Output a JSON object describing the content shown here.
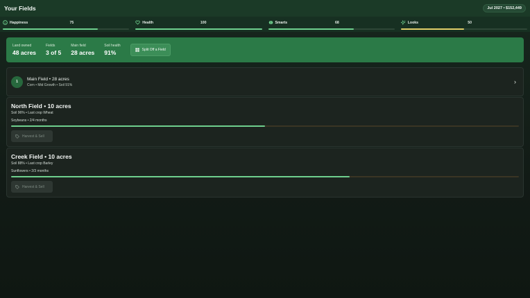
{
  "header": {
    "title": "Your Fields",
    "date": "Jul 2027",
    "money": "$152,449"
  },
  "stats": [
    {
      "label": "Happiness",
      "value": "75",
      "fill": 0.75,
      "icon": "smiley-icon",
      "color": "#6fd08e"
    },
    {
      "label": "Health",
      "value": "100",
      "fill": 1.0,
      "icon": "heart-icon",
      "color": "#6fd08e"
    },
    {
      "label": "Smarts",
      "value": "68",
      "fill": 0.68,
      "icon": "brain-icon",
      "color": "#6fd08e"
    },
    {
      "label": "Looks",
      "value": "50",
      "fill": 0.5,
      "icon": "sparkle-icon",
      "color": "#e2cf6a"
    }
  ],
  "summary": {
    "land_label": "Land owned",
    "land_value": "48 acres",
    "fields_label": "Fields",
    "fields_value": "3 of 5",
    "main_label": "Main field",
    "main_value": "28 acres",
    "soil_label": "Soil health",
    "soil_value": "91%",
    "split_label": "Split Off a Field"
  },
  "main_field": {
    "number": "1",
    "title": "Main Field • 28 acres",
    "subtitle": "Corn • Mid Growth • Soil 91%"
  },
  "fields": [
    {
      "title": "North Field • 10 acres",
      "soil_line": "Soil 96% • Last crop Wheat",
      "crop_line": "Soybeans • 2/4 months",
      "progress": 0.5,
      "harvest_label": "Harvest & Sell"
    },
    {
      "title": "Creek Field • 10 acres",
      "soil_line": "Soil 88% • Last crop Barley",
      "crop_line": "Sunflowers • 2/3 months",
      "progress": 0.667,
      "harvest_label": "Harvest & Sell"
    }
  ]
}
